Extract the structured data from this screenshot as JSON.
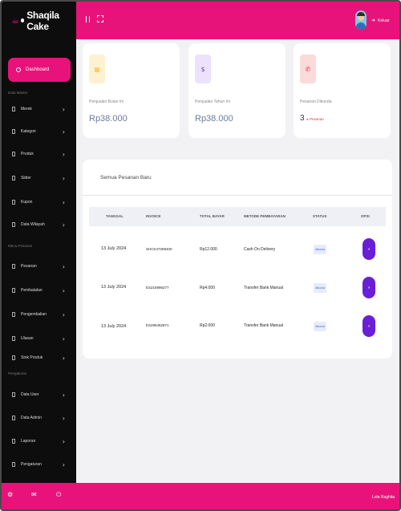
{
  "brand": {
    "icon": "☕",
    "name": "Shaqila Cake"
  },
  "sidebar": {
    "dashboard_label": "Dashboard",
    "section_master": "Data Master",
    "master_items": [
      {
        "label": "Merek"
      },
      {
        "label": "Kategori"
      },
      {
        "label": "Produk"
      },
      {
        "label": "Slider"
      },
      {
        "label": "Kupon"
      },
      {
        "label": "Data Wilayah"
      }
    ],
    "section_transaksi": "Menu Pesanan",
    "transaksi_items": [
      {
        "label": "Pesanan"
      },
      {
        "label": "Pembatalan"
      },
      {
        "label": "Pengembalian"
      },
      {
        "label": "Ulasan"
      },
      {
        "label": "Stok Produk"
      }
    ],
    "section_pengaturan": "Pengaturan",
    "pengaturan_items": [
      {
        "label": "Data User"
      },
      {
        "label": "Data Admin"
      },
      {
        "label": "Laporan"
      },
      {
        "label": "Pengaturan"
      }
    ],
    "chevron": "›"
  },
  "topbar": {
    "logout_icon": "➜",
    "logout_label": "Keluar"
  },
  "stats": [
    {
      "icon_name": "calendar-icon",
      "icon": "▦",
      "label": "Penjualan Bulan Ini",
      "value": "Rp38.000",
      "color": "#f6c344",
      "bg": "#fdf1d2"
    },
    {
      "icon_name": "money-icon",
      "icon": "$",
      "label": "Penjualan Tahun Ini",
      "value": "Rp38.000",
      "color": "#7a3be0",
      "bg": "#ece2fb"
    },
    {
      "icon_name": "phone-icon",
      "icon": "✆",
      "label": "Pesanan Dikunda",
      "value": "3",
      "badge": "▸ Pesanan",
      "color": "#e0324a",
      "bg": "#fbdada"
    }
  ],
  "orders": {
    "title": "Semua Pesanan Baru",
    "columns": [
      "TANGGAL",
      "INVOICE",
      "TOTAL BAYAR",
      "METODE PEMBAYARAN",
      "STATUS",
      "OPSI"
    ],
    "rows": [
      {
        "date": "13 July 2024",
        "invoice": "SHCK47259400",
        "total": "Rp12.000",
        "method": "Cash On Delivery",
        "status": "dikunda",
        "action": "»"
      },
      {
        "date": "13 July 2024",
        "invoice": "ES216996277",
        "total": "Rp4.000",
        "method": "Transfer Bank Manual",
        "status": "dikunda",
        "action": "»"
      },
      {
        "date": "13 July 2024",
        "invoice": "ES295452871",
        "total": "Rp2.000",
        "method": "Transfer Bank Manual",
        "status": "dikunda",
        "action": "»"
      }
    ]
  },
  "footer": {
    "icons": [
      "⚙",
      "✉",
      "⏻"
    ],
    "name": "Lola Raghita"
  },
  "colors": {
    "accent": "#e8137a",
    "sidebar": "#0d0d0d",
    "opsi": "#6a1ed8"
  }
}
